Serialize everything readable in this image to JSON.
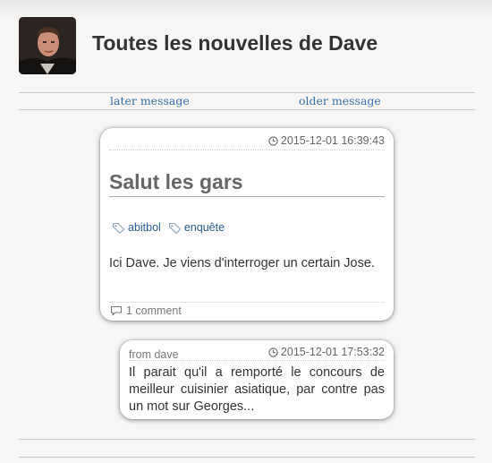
{
  "header": {
    "title": "Toutes les nouvelles de Dave"
  },
  "nav": {
    "later": "later message",
    "older": "older message"
  },
  "post": {
    "date": "2015-12-01 16:39:43",
    "title": "Salut les gars",
    "tags": [
      "abitbol",
      "enquête"
    ],
    "body": "Ici Dave. Je viens d'interroger un certain Jose.",
    "comments": "1 comment"
  },
  "comment": {
    "from": "from dave",
    "date": "2015-12-01 17:53:32",
    "body": "Il parait qu'il a remporté le concours de meilleur cuisinier asiatique, par contre pas un mot sur Georges..."
  },
  "colors": {
    "link": "#3a6fa6",
    "tag": "#2a5c94",
    "background": "#f7f6f4"
  },
  "icons": {
    "date": "clock-icon",
    "tag": "tag-icon",
    "comments": "speech-bubble-icon"
  }
}
